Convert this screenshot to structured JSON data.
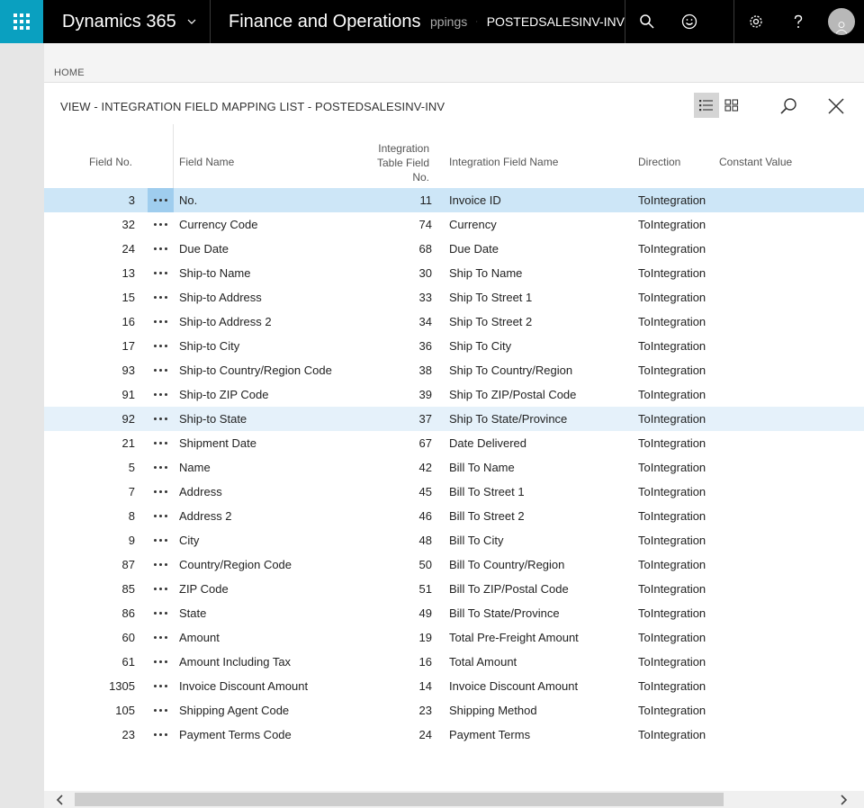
{
  "topbar": {
    "brand": "Dynamics 365",
    "app_name": "Finance and Operations",
    "breadcrumb_prev": "ppings",
    "breadcrumb_current": "POSTEDSALESINV-INV"
  },
  "page": {
    "home_label": "HOME",
    "view_title": "VIEW - INTEGRATION FIELD MAPPING LIST - POSTEDSALESINV-INV"
  },
  "columns": {
    "field_no": "Field No.",
    "field_name": "Field Name",
    "int_table_field_no_line1": "Integration",
    "int_table_field_no_line2": "Table Field",
    "int_table_field_no_line3": "No.",
    "int_field_name": "Integration Field Name",
    "direction": "Direction",
    "constant_value": "Constant Value"
  },
  "rows": [
    {
      "field_no": "3",
      "field_name": "No.",
      "int_no": "11",
      "int_name": "Invoice ID",
      "direction": "ToIntegration",
      "state": "selected"
    },
    {
      "field_no": "32",
      "field_name": "Currency Code",
      "int_no": "74",
      "int_name": "Currency",
      "direction": "ToIntegration",
      "state": ""
    },
    {
      "field_no": "24",
      "field_name": "Due Date",
      "int_no": "68",
      "int_name": "Due Date",
      "direction": "ToIntegration",
      "state": ""
    },
    {
      "field_no": "13",
      "field_name": "Ship-to Name",
      "int_no": "30",
      "int_name": "Ship To Name",
      "direction": "ToIntegration",
      "state": ""
    },
    {
      "field_no": "15",
      "field_name": "Ship-to Address",
      "int_no": "33",
      "int_name": "Ship To Street 1",
      "direction": "ToIntegration",
      "state": ""
    },
    {
      "field_no": "16",
      "field_name": "Ship-to Address 2",
      "int_no": "34",
      "int_name": "Ship To Street 2",
      "direction": "ToIntegration",
      "state": ""
    },
    {
      "field_no": "17",
      "field_name": "Ship-to City",
      "int_no": "36",
      "int_name": "Ship To City",
      "direction": "ToIntegration",
      "state": ""
    },
    {
      "field_no": "93",
      "field_name": "Ship-to Country/Region Code",
      "int_no": "38",
      "int_name": "Ship To Country/Region",
      "direction": "ToIntegration",
      "state": ""
    },
    {
      "field_no": "91",
      "field_name": "Ship-to ZIP Code",
      "int_no": "39",
      "int_name": "Ship To ZIP/Postal Code",
      "direction": "ToIntegration",
      "state": ""
    },
    {
      "field_no": "92",
      "field_name": "Ship-to State",
      "int_no": "37",
      "int_name": "Ship To State/Province",
      "direction": "ToIntegration",
      "state": "hover"
    },
    {
      "field_no": "21",
      "field_name": "Shipment Date",
      "int_no": "67",
      "int_name": "Date Delivered",
      "direction": "ToIntegration",
      "state": ""
    },
    {
      "field_no": "5",
      "field_name": "Name",
      "int_no": "42",
      "int_name": "Bill To Name",
      "direction": "ToIntegration",
      "state": ""
    },
    {
      "field_no": "7",
      "field_name": "Address",
      "int_no": "45",
      "int_name": "Bill To Street 1",
      "direction": "ToIntegration",
      "state": ""
    },
    {
      "field_no": "8",
      "field_name": "Address 2",
      "int_no": "46",
      "int_name": "Bill To Street 2",
      "direction": "ToIntegration",
      "state": ""
    },
    {
      "field_no": "9",
      "field_name": "City",
      "int_no": "48",
      "int_name": "Bill To City",
      "direction": "ToIntegration",
      "state": ""
    },
    {
      "field_no": "87",
      "field_name": "Country/Region Code",
      "int_no": "50",
      "int_name": "Bill To Country/Region",
      "direction": "ToIntegration",
      "state": ""
    },
    {
      "field_no": "85",
      "field_name": "ZIP Code",
      "int_no": "51",
      "int_name": "Bill To ZIP/Postal Code",
      "direction": "ToIntegration",
      "state": ""
    },
    {
      "field_no": "86",
      "field_name": "State",
      "int_no": "49",
      "int_name": "Bill To State/Province",
      "direction": "ToIntegration",
      "state": ""
    },
    {
      "field_no": "60",
      "field_name": "Amount",
      "int_no": "19",
      "int_name": "Total Pre-Freight Amount",
      "direction": "ToIntegration",
      "state": ""
    },
    {
      "field_no": "61",
      "field_name": "Amount Including Tax",
      "int_no": "16",
      "int_name": "Total Amount",
      "direction": "ToIntegration",
      "state": ""
    },
    {
      "field_no": "1305",
      "field_name": "Invoice Discount Amount",
      "int_no": "14",
      "int_name": "Invoice Discount Amount",
      "direction": "ToIntegration",
      "state": ""
    },
    {
      "field_no": "105",
      "field_name": "Shipping Agent Code",
      "int_no": "23",
      "int_name": "Shipping Method",
      "direction": "ToIntegration",
      "state": ""
    },
    {
      "field_no": "23",
      "field_name": "Payment Terms Code",
      "int_no": "24",
      "int_name": "Payment Terms",
      "direction": "ToIntegration",
      "state": ""
    }
  ],
  "colors": {
    "accent": "#0aa0c0",
    "selected_row": "#cde6f7",
    "hover_row": "#e5f1fa"
  },
  "icons": [
    "waffle-icon",
    "chevron-down-icon",
    "chevron-right-icon",
    "search-icon",
    "smiley-icon",
    "gear-icon",
    "help-icon",
    "avatar-icon",
    "list-view-icon",
    "tile-view-icon",
    "close-icon",
    "more-dots-icon"
  ]
}
